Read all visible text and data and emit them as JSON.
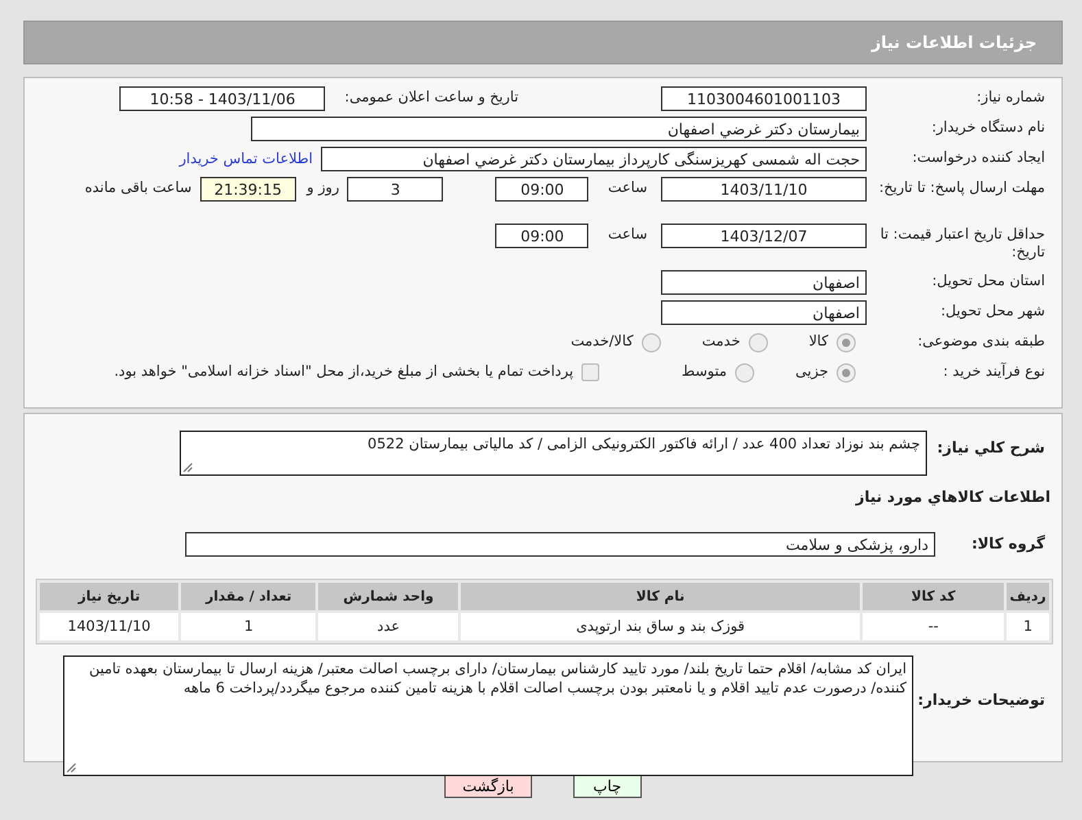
{
  "page_title": "جزئیات اطلاعات نیاز",
  "need_number": {
    "label": "شماره نیاز:",
    "value": "1103004601001103"
  },
  "announce_datetime": {
    "label": "تاریخ و ساعت اعلان عمومی:",
    "value": "1403/11/06 - 10:58"
  },
  "buyer_org": {
    "label": "نام دستگاه خریدار:",
    "value": "بیمارستان دکتر غرضي اصفهان"
  },
  "requester": {
    "label": "ایجاد کننده درخواست:",
    "value": "حجت اله شمسی کهریزسنگی کارپرداز بیمارستان دکتر غرضي اصفهان",
    "link": "اطلاعات تماس خریدار"
  },
  "reply_deadline": {
    "label": "مهلت ارسال پاسخ: تا تاریخ:",
    "date": "1403/11/10",
    "time_label": "ساعت",
    "time": "09:00",
    "days": "3",
    "days_label": "روز و",
    "remaining": "21:39:15",
    "remaining_label": "ساعت باقی مانده"
  },
  "price_validity": {
    "label": "حداقل تاریخ اعتبار قیمت: تا تاریخ:",
    "date": "1403/12/07",
    "time_label": "ساعت",
    "time": "09:00"
  },
  "province": {
    "label": "استان محل تحویل:",
    "value": "اصفهان"
  },
  "city": {
    "label": "شهر محل تحویل:",
    "value": "اصفهان"
  },
  "category": {
    "label": "طبقه بندی موضوعی:",
    "options": [
      {
        "label": "کالا",
        "selected": true
      },
      {
        "label": "خدمت",
        "selected": false
      },
      {
        "label": "کالا/خدمت",
        "selected": false
      }
    ]
  },
  "purchase_type": {
    "label": "نوع فرآیند خرید :",
    "options": [
      {
        "label": "جزیی",
        "selected": true
      },
      {
        "label": "متوسط",
        "selected": false
      }
    ],
    "treasury": {
      "label": "پرداخت تمام یا بخشی از مبلغ خرید،از محل \"اسناد خزانه اسلامی\" خواهد بود.",
      "checked": false
    }
  },
  "description": {
    "label": "شرح کلي نیاز:",
    "value": "چشم بند نوزاد تعداد 400 عدد / ارائه فاکتور الکترونیکی الزامی / کد مالیاتی بیمارستان 0522"
  },
  "goods_heading": "اطلاعات کالاهاي مورد نیاز",
  "goods_group": {
    "label": "گروه کالا:",
    "value": "دارو، پزشکی و سلامت"
  },
  "table": {
    "columns": [
      "ردیف",
      "کد کالا",
      "نام کالا",
      "واحد شمارش",
      "تعداد / مقدار",
      "تاریخ نیاز"
    ],
    "rows": [
      [
        "1",
        "--",
        "قوزک بند و ساق بند ارتوپدی",
        "عدد",
        "1",
        "1403/11/10"
      ]
    ]
  },
  "buyer_notes": {
    "label": "توضیحات خریدار:",
    "value": "ایران کد مشابه/ اقلام حتما تاریخ بلند/ مورد تایید کارشناس بیمارستان/ دارای برچسب اصالت معتبر/ هزینه ارسال تا بیمارستان بعهده تامین کننده/ درصورت عدم تایید اقلام و یا نامعتبر بودن برچسب اصالت اقلام با هزینه تامین کننده مرجوع میگردد/پرداخت 6 ماهه"
  },
  "buttons": [
    {
      "label": "چاپ",
      "kind": "print"
    },
    {
      "label": "بازگشت",
      "kind": "back"
    }
  ]
}
